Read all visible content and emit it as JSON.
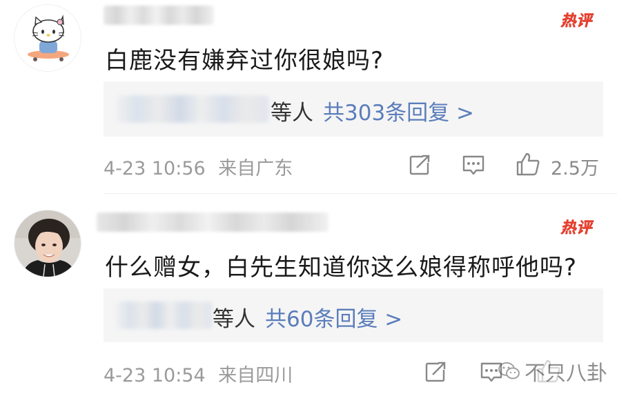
{
  "comments": [
    {
      "hot_badge": "热评",
      "text": "白鹿没有嫌弃过你很娘吗?",
      "reply_users_suffix": "等人",
      "reply_count": "共303条回复 >",
      "timestamp": "4-23 10:56",
      "location": "来自广东",
      "like_count": "2.5万",
      "avatar_icon": "hello-kitty-avatar"
    },
    {
      "hot_badge": "热评",
      "text": "什么赠女，白先生知道你这么娘得称呼他吗?",
      "reply_users_suffix": "等人",
      "reply_count": "共60条回复 >",
      "timestamp": "4-23 10:54",
      "location": "来自四川",
      "like_count": "",
      "avatar_icon": "young-man-photo-avatar"
    }
  ],
  "watermark": {
    "text": "不只八卦",
    "icon": "wechat-icon"
  },
  "colors": {
    "hot": "#e8432e",
    "link": "#5a7dbb",
    "meta": "#9a9a9a",
    "reply_bg": "#f5f5f5"
  }
}
